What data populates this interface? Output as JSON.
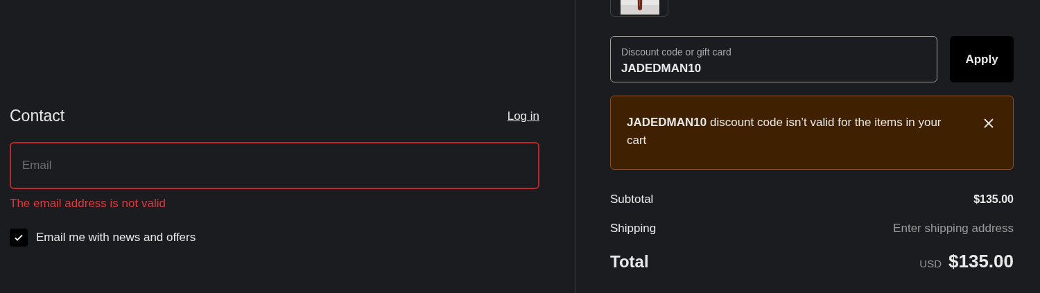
{
  "contact": {
    "title": "Contact",
    "login_link": "Log in",
    "email": {
      "placeholder": "Email",
      "invalid": true,
      "error": "The email address is not valid"
    },
    "newsletter": {
      "label": "Email me with news and offers",
      "checked": true
    }
  },
  "summary": {
    "discount": {
      "label": "Discount code or gift card",
      "value": "JADEDMAN10",
      "button": "Apply"
    },
    "alert": {
      "message": "**JADEDMAN10** discount code isn’t valid for the items in your cart",
      "dismissible": true
    },
    "lines": [
      {
        "label": "Subtotal",
        "value": "$135.00",
        "kind": "amount"
      },
      {
        "label": "Shipping",
        "value": "Enter shipping address",
        "kind": "note"
      }
    ],
    "total": {
      "label": "Total",
      "currency": "USD",
      "value": "$135.00"
    }
  }
}
